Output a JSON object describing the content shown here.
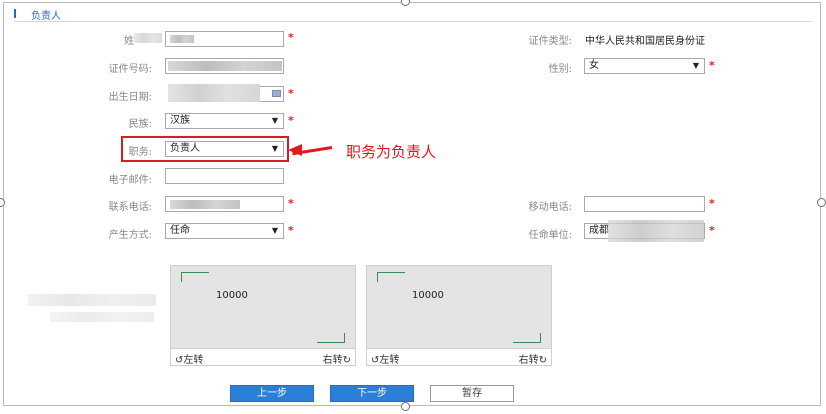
{
  "section": {
    "title": "负责人"
  },
  "fields": {
    "surname_label": "姓",
    "id_type_label": "证件类型:",
    "id_type_value": "中华人民共和国居民身份证",
    "id_number_label": "证件号码:",
    "gender_label": "性别:",
    "gender_value": "女",
    "birthdate_label": "出生日期:",
    "ethnicity_label": "民族:",
    "ethnicity_value": "汉族",
    "position_label": "职务:",
    "position_value": "负责人",
    "email_label": "电子邮件:",
    "phone_label": "联系电话:",
    "mobile_label": "移动电话:",
    "method_label": "产生方式:",
    "method_value": "任命",
    "unit_label": "任命单位:",
    "unit_value": "成都"
  },
  "required_mark": "*",
  "annotation": {
    "text": "职务为负责人"
  },
  "id_cards": [
    {
      "number": "10000",
      "rotate_left": "左转",
      "rotate_right": "右转"
    },
    {
      "number": "10000",
      "rotate_left": "左转",
      "rotate_right": "右转"
    }
  ],
  "buttons": {
    "prev": "上一步",
    "next": "下一步",
    "save_draft": "暂存"
  },
  "icons": {
    "dropdown": "chevron-down-icon",
    "rotate_ccw": "rotate-ccw-icon",
    "rotate_cw": "rotate-cw-icon",
    "calendar": "calendar-icon"
  },
  "colors": {
    "accent": "#1f6fc6",
    "required": "#e02020",
    "annotation": "#e0191e",
    "primary_button": "#2b7fd6"
  }
}
